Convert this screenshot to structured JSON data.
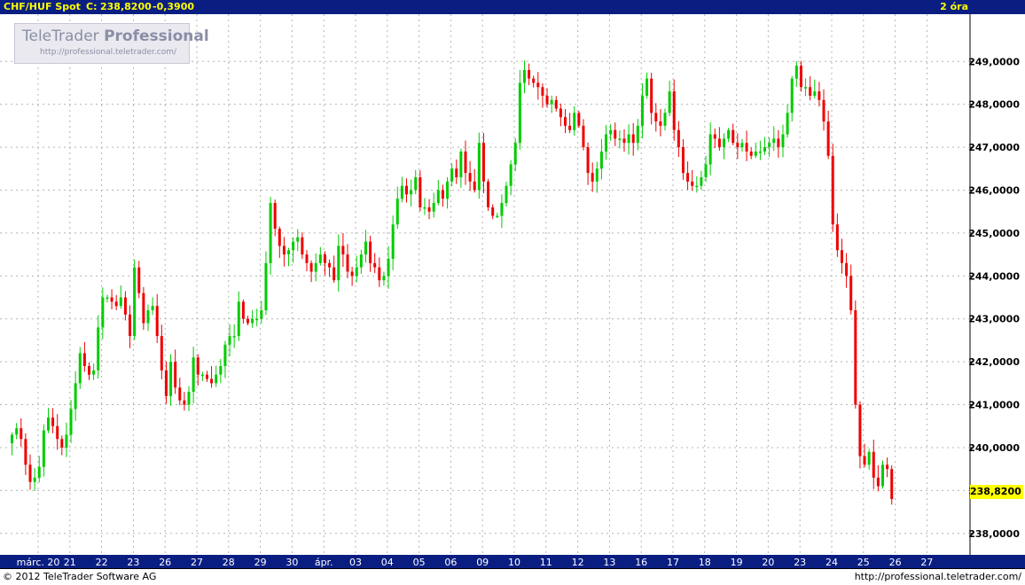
{
  "header": {
    "symbol": "CHF/HUF Spot",
    "close_label": "C:",
    "close_value": "238,8200",
    "change": "-0,3900",
    "interval": "2 óra"
  },
  "logo": {
    "name_regular": "TeleTrader",
    "name_bold": "Professional",
    "url": "http://professional.teletrader.com/"
  },
  "footer": {
    "copyright": "© 2012 TeleTrader Software AG",
    "url": "http://professional.teletrader.com/"
  },
  "last_price_label": "238,8200",
  "colors": {
    "up": "#00cc00",
    "down": "#ee0000",
    "title_bg": "#0a1e82",
    "title_text": "#ffff00",
    "grid": "#b4b4b4"
  },
  "chart_data": {
    "type": "candlestick",
    "title": "CHF/HUF Spot",
    "x_tick_labels": [
      "márc. 20",
      "21",
      "22",
      "23",
      "26",
      "27",
      "28",
      "29",
      "30",
      "ápr.",
      "03",
      "04",
      "05",
      "06",
      "09",
      "10",
      "11",
      "12",
      "13",
      "16",
      "17",
      "18",
      "19",
      "20",
      "23",
      "24",
      "25",
      "26",
      "27"
    ],
    "y_tick_labels": [
      "249,0000",
      "248,0000",
      "247,0000",
      "246,0000",
      "245,0000",
      "244,0000",
      "243,0000",
      "242,0000",
      "241,0000",
      "240,0000",
      "239,0000",
      "238,0000"
    ],
    "y_ticks": [
      249,
      248,
      247,
      246,
      245,
      244,
      243,
      242,
      241,
      240,
      239,
      238
    ],
    "ylim": [
      237.5,
      250.1
    ],
    "grid": true,
    "last_value": 238.82,
    "close_path_by_day": [
      [
        "márc. 20",
        [
          240.3,
          240.45,
          240.2,
          239.6,
          239.2,
          239.3,
          239.55
        ]
      ],
      [
        "21",
        [
          240.4,
          240.7,
          240.5,
          240.2,
          240.0,
          240.3,
          240.9
        ]
      ],
      [
        "22",
        [
          241.5,
          242.2,
          241.9,
          241.7,
          241.8,
          242.8,
          243.5
        ]
      ],
      [
        "23",
        [
          243.5,
          243.4,
          243.3,
          243.5,
          243.1,
          242.6,
          244.2
        ]
      ],
      [
        "26",
        [
          243.6,
          242.9,
          243.2,
          243.3,
          242.6,
          241.8,
          241.2
        ]
      ],
      [
        "27",
        [
          242.0,
          241.4,
          241.1,
          241.0,
          241.3,
          242.1,
          241.7
        ]
      ],
      [
        "28",
        [
          241.7,
          241.6,
          241.5,
          241.7,
          241.9,
          242.4,
          242.6
        ]
      ],
      [
        "29",
        [
          242.6,
          243.4,
          243.0,
          242.9,
          243.0,
          243.0,
          243.2
        ]
      ],
      [
        "30",
        [
          244.3,
          245.7,
          245.1,
          244.7,
          244.5,
          244.6,
          244.8
        ]
      ],
      [
        "ápr.",
        [
          244.9,
          244.5,
          244.3,
          244.1,
          244.3,
          244.5,
          244.3
        ]
      ],
      [
        "03",
        [
          244.2,
          243.9,
          244.7,
          244.5,
          244.1,
          244.0,
          244.2
        ]
      ],
      [
        "04",
        [
          244.5,
          244.8,
          244.3,
          244.2,
          243.9,
          244.0,
          244.4
        ]
      ],
      [
        "05",
        [
          245.2,
          245.8,
          246.1,
          245.9,
          246.0,
          246.3,
          245.6
        ]
      ],
      [
        "06",
        [
          245.6,
          245.5,
          245.7,
          246.0,
          245.8,
          246.2,
          246.5
        ]
      ],
      [
        "09",
        [
          246.3,
          246.9,
          246.4,
          246.2,
          246.0,
          247.1,
          246.2
        ]
      ],
      [
        "10",
        [
          245.6,
          245.4,
          245.4,
          245.7,
          246.1,
          246.6,
          247.1
        ]
      ],
      [
        "11",
        [
          248.5,
          248.8,
          248.6,
          248.5,
          248.4,
          248.2,
          248.0
        ]
      ],
      [
        "12",
        [
          248.1,
          247.9,
          247.7,
          247.5,
          247.4,
          247.8,
          247.5
        ]
      ],
      [
        "13",
        [
          247.0,
          246.4,
          246.2,
          246.5,
          246.9,
          247.3,
          247.4
        ]
      ],
      [
        "16",
        [
          247.2,
          247.2,
          247.1,
          247.3,
          247.1,
          247.5,
          248.2
        ]
      ],
      [
        "17",
        [
          248.6,
          247.8,
          247.6,
          247.5,
          247.8,
          248.3,
          247.4
        ]
      ],
      [
        "18",
        [
          247.0,
          246.4,
          246.2,
          246.1,
          246.1,
          246.3,
          246.6
        ]
      ],
      [
        "19",
        [
          247.3,
          247.2,
          247.0,
          247.2,
          247.4,
          247.1,
          247.0
        ]
      ],
      [
        "20",
        [
          247.1,
          246.9,
          246.8,
          246.9,
          246.9,
          247.0,
          247.1
        ]
      ],
      [
        "23",
        [
          247.2,
          247.0,
          247.3,
          247.8,
          248.6,
          248.9,
          248.4
        ]
      ],
      [
        "24",
        [
          248.4,
          248.2,
          248.3,
          248.1,
          247.6,
          246.8,
          245.2
        ]
      ],
      [
        "25",
        [
          244.6,
          244.3,
          244.0,
          243.2,
          241.0,
          239.8,
          239.6
        ]
      ],
      [
        "26",
        [
          239.9,
          239.3,
          239.1,
          239.6,
          239.5,
          238.8
        ]
      ]
    ]
  }
}
